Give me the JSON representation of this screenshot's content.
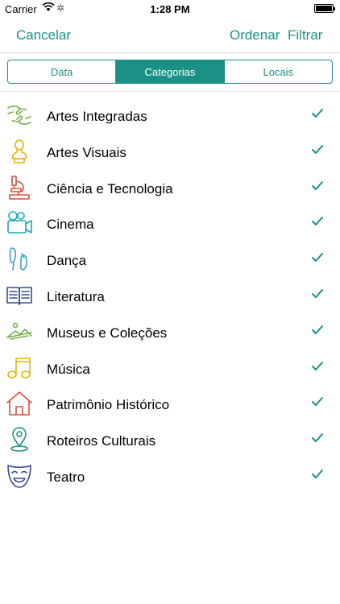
{
  "status_bar": {
    "carrier": "Carrier",
    "time": "1:28 PM"
  },
  "nav": {
    "cancel": "Cancelar",
    "order": "Ordenar",
    "filter": "Filtrar"
  },
  "segments": [
    "Data",
    "Categorias",
    "Locais"
  ],
  "selected_segment": "Categorias",
  "colors": {
    "accent": "#1a9184"
  },
  "categories": [
    {
      "label": "Artes Integradas",
      "icon": "hands-icon",
      "color": "#74b04a",
      "checked": true
    },
    {
      "label": "Artes Visuais",
      "icon": "bust-icon",
      "color": "#e8b400",
      "checked": true
    },
    {
      "label": "Ciência e Tecnologia",
      "icon": "microscope-icon",
      "color": "#d9503f",
      "checked": true
    },
    {
      "label": "Cinema",
      "icon": "camera-icon",
      "color": "#1fa6b8",
      "checked": true
    },
    {
      "label": "Dança",
      "icon": "ballet-shoes-icon",
      "color": "#3aa0d8",
      "checked": true
    },
    {
      "label": "Literatura",
      "icon": "book-icon",
      "color": "#3d4a98",
      "checked": true
    },
    {
      "label": "Museus e Coleções",
      "icon": "landscape-icon",
      "color": "#74b04a",
      "checked": true
    },
    {
      "label": "Música",
      "icon": "music-note-icon",
      "color": "#e8b400",
      "checked": true
    },
    {
      "label": "Patrimônio Histórico",
      "icon": "house-icon",
      "color": "#d9503f",
      "checked": true
    },
    {
      "label": "Roteiros Culturais",
      "icon": "map-pin-icon",
      "color": "#1a9184",
      "checked": true
    },
    {
      "label": "Teatro",
      "icon": "theater-mask-icon",
      "color": "#3d4a98",
      "checked": true
    }
  ]
}
